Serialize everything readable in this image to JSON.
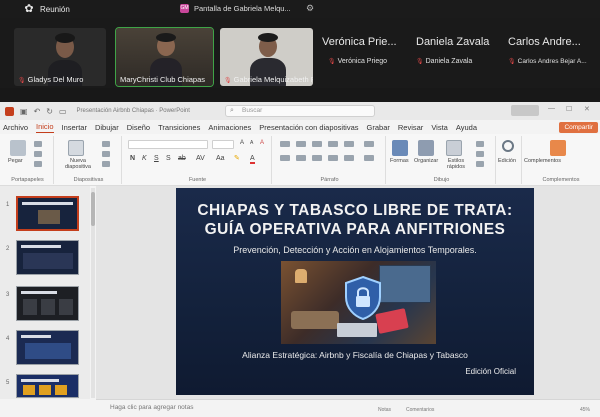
{
  "meeting": {
    "title": "Reunión",
    "share_label": "Pantalla de Gabriela Melqu...",
    "share_badge": "GM"
  },
  "participants": [
    {
      "name": "Gladys Del Muro"
    },
    {
      "name": "MaryChristi Club Chiapas"
    },
    {
      "name": "Gabriela Melquizabeth P..."
    },
    {
      "name_big": "Verónica Prie...",
      "name": "Verónica Priego"
    },
    {
      "name_big": "Daniela Zavala",
      "name": "Daniela Zavala"
    },
    {
      "name_big": "Carlos Andre...",
      "name": "Carlos Andres Bejar A..."
    }
  ],
  "powerpoint": {
    "doc_title": "Presentación Airbnb Chiapas · PowerPoint",
    "search_placeholder": "Buscar",
    "menu": [
      "Archivo",
      "Inicio",
      "Insertar",
      "Dibujar",
      "Diseño",
      "Transiciones",
      "Animaciones",
      "Presentación con diapositivas",
      "Grabar",
      "Revisar",
      "Vista",
      "Ayuda"
    ],
    "active_menu": "Inicio",
    "share_button": "Compartir",
    "ribbon": {
      "paste": "Pegar",
      "new_slide": "Nueva diapositiva",
      "shapes": "Formas",
      "arrange": "Organizar",
      "quick_styles": "Estilos rápidos",
      "editing": "Edición",
      "addins": "Complementos",
      "groups": [
        "Portapapeles",
        "Diapositivas",
        "Fuente",
        "Párrafo",
        "Dibujo",
        "Complementos"
      ]
    },
    "thumbnail_numbers": [
      "1",
      "2",
      "3",
      "4",
      "5"
    ],
    "notes_placeholder": "Haga clic para agregar notas",
    "status": {
      "notes": "Notas",
      "comments": "Comentarios",
      "zoom": "45%"
    }
  },
  "slide": {
    "title_line1": "CHIAPAS Y TABASCO LIBRE DE TRATA:",
    "title_line2": "GUÍA OPERATIVA PARA ANFITRIONES",
    "subtitle": "Prevención, Detección y Acción en Alojamientos Temporales.",
    "alliance": "Alianza Estratégica: Airbnb y Fiscalía de Chiapas y Tabasco",
    "edition": "Edición Oficial"
  },
  "colors": {
    "accent": "#c43e1c",
    "slide_bg": "#14223e",
    "active_tile": "#3fa447"
  }
}
